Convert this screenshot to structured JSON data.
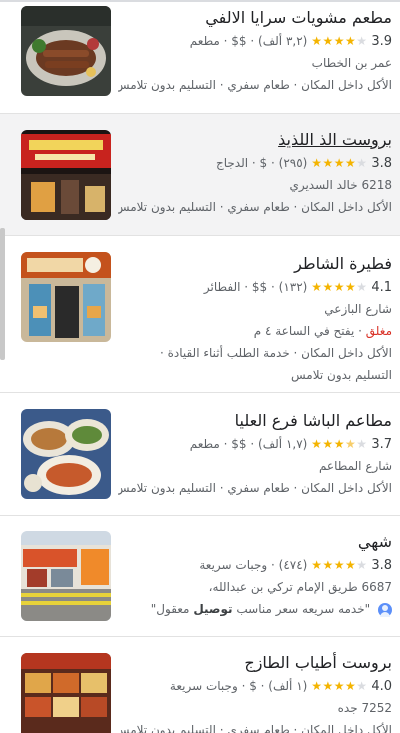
{
  "results": [
    {
      "name": "مطعم مشويات سرايا الالفي",
      "rating": "3.9",
      "stars": 4,
      "reviews": "(٣,٢ ألف)",
      "price": "$$",
      "category": "مطعم",
      "address": "عمر بن الخطاب",
      "services": "الأكل داخل المكان · طعام سفري · التسليم بدون تلامس"
    },
    {
      "name": "بروست الذ اللذيذ",
      "rating": "3.8",
      "stars": 4,
      "reviews": "(٢٩٥)",
      "price": "$",
      "category": "الدجاج",
      "address": "6218 خالد السديري",
      "services": "الأكل داخل المكان · طعام سفري · التسليم بدون تلامس"
    },
    {
      "name": "فطيرة الشاطر",
      "rating": "4.1",
      "stars": 4,
      "reviews": "(١٣٢)",
      "price": "$$",
      "category": "الفطائر",
      "address": "شارع البازعي",
      "status_closed": "مغلق",
      "status_opens": "· يفتح في الساعة ٤ م",
      "services": "الأكل داخل المكان · خدمة الطلب أثناء القيادة ·",
      "services2": "التسليم بدون تلامس"
    },
    {
      "name": "مطاعم الباشا فرع العليا",
      "rating": "3.7",
      "stars": 4,
      "reviews": "(١,٧ ألف)",
      "price": "$$",
      "category": "مطعم",
      "address": "شارع المطاعم",
      "services": "الأكل داخل المكان · طعام سفري · التسليم بدون تلامس"
    },
    {
      "name": "شهي",
      "rating": "3.8",
      "stars": 4,
      "reviews": "(٤٧٤)",
      "category": "وجبات سريعة",
      "address": "6687 طريق الإمام تركي بن عبدالله،",
      "review_quote": "\"خدمه سريعه سعر مناسب",
      "review_bold": "توصيل",
      "review_end": "معقول\""
    },
    {
      "name": "بروست أطياب الطازج",
      "rating": "4.0",
      "stars": 4,
      "reviews": "(١ ألف)",
      "price": "$",
      "category": "وجبات سريعة",
      "address": "7252 جده",
      "services": "الأكل داخل المكان · طعام سفري · التسليم بدون تلامس"
    }
  ],
  "colors": {
    "star": "#f4b400",
    "closed": "#d93025",
    "highlight": "#f3f3f4"
  }
}
